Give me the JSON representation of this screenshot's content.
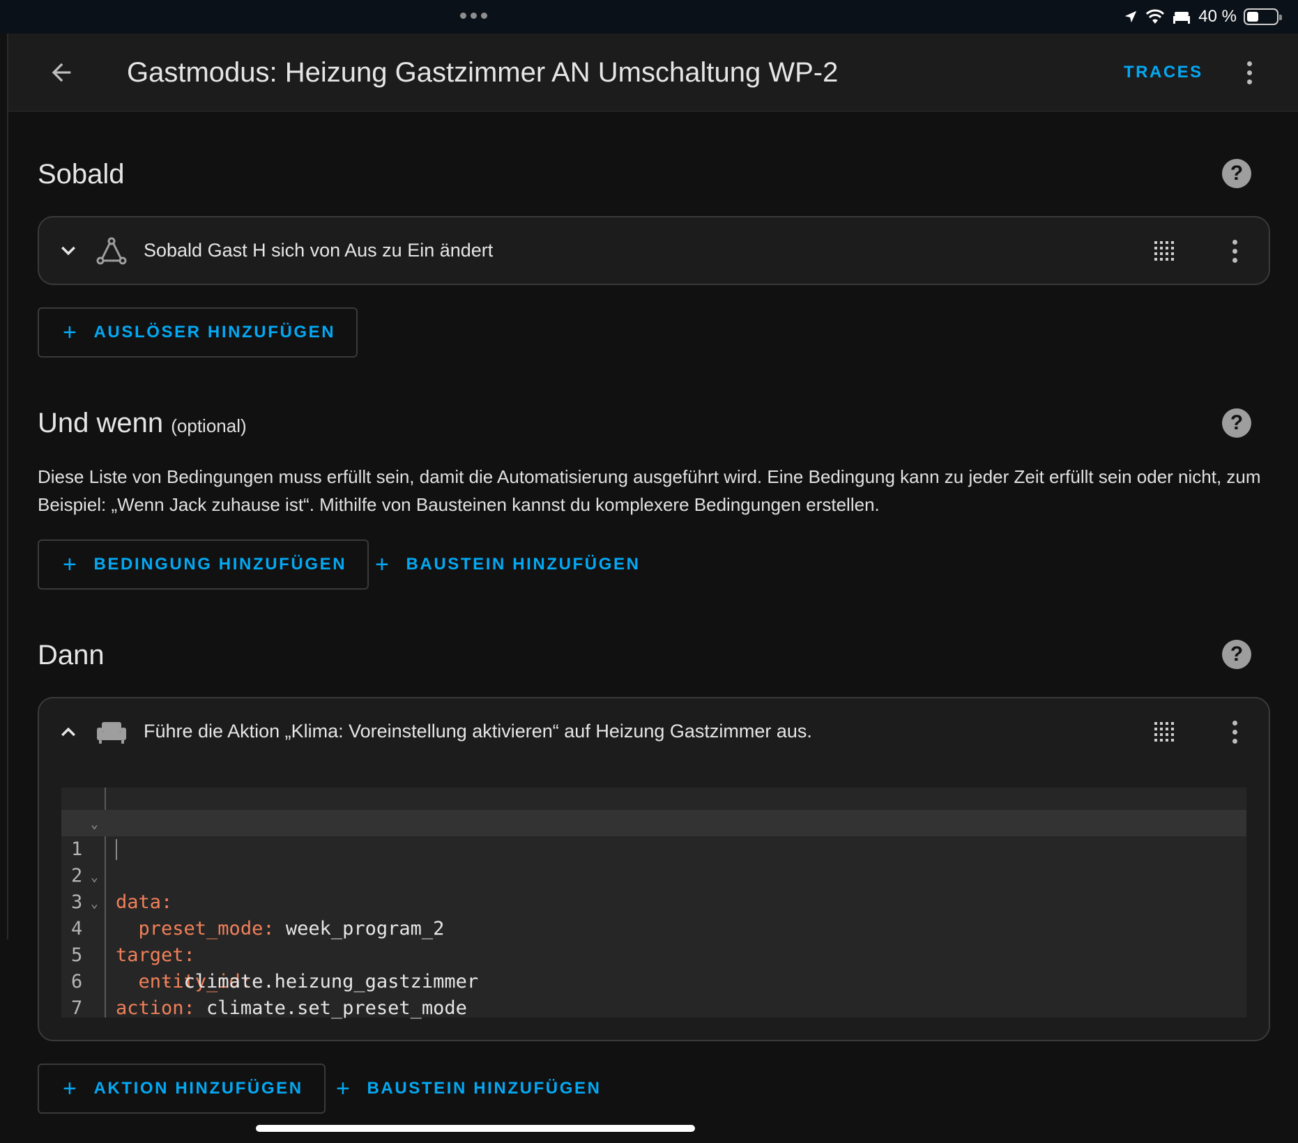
{
  "status_bar": {
    "battery_percent": "40 %",
    "battery_level": 0.4,
    "icons": [
      "location-arrow-icon",
      "wifi-icon",
      "bed-icon",
      "battery-icon"
    ]
  },
  "header": {
    "title": "Gastmodus: Heizung Gastzimmer AN Umschaltung WP-2",
    "traces_label": "TRACES",
    "icons": [
      "arrow-left-icon",
      "dots-vertical-icon"
    ]
  },
  "triggers": {
    "title": "Sobald",
    "items": [
      {
        "text": "Sobald Gast H sich von Aus zu Ein ändert",
        "icon": "state-graph-icon",
        "expanded": false
      }
    ],
    "add_label": "AUSLÖSER HINZUFÜGEN"
  },
  "conditions": {
    "title": "Und wenn",
    "optional_label": "(optional)",
    "description": "Diese Liste von Bedingungen muss erfüllt sein, damit die Automatisierung ausgeführt wird. Eine Bedingung kann zu jeder Zeit erfüllt sein oder nicht, zum Beispiel: „Wenn Jack zuhause ist“. Mithilfe von Bausteinen kannst du komplexere Bedingungen erstellen.",
    "add_condition_label": "BEDINGUNG HINZUFÜGEN",
    "add_block_label": "BAUSTEIN HINZUFÜGEN"
  },
  "actions": {
    "title": "Dann",
    "items": [
      {
        "text": "Führe die Aktion „Klima: Voreinstellung aktivieren“ auf Heizung Gastzimmer aus.",
        "icon": "sofa-icon",
        "expanded": true
      }
    ],
    "yaml": {
      "line_numbers": [
        "1",
        "2",
        "3",
        "4",
        "5",
        "6",
        "7"
      ],
      "l1_key": "data:",
      "l2_key": "preset_mode:",
      "l2_value": " week_program_2",
      "l3_key": "target:",
      "l4_key": "entity_id:",
      "l5_dash": "- ",
      "l5_value": "climate.heizung_gastzimmer",
      "l6_key": "action:",
      "l6_value": " climate.set_preset_mode"
    },
    "add_action_label": "AKTION HINZUFÜGEN",
    "add_block_label": "BAUSTEIN HINZUFÜGEN"
  },
  "colors": {
    "accent": "#03a9f4",
    "background": "#111111",
    "card": "#1c1c1c",
    "yaml_key": "#f0805a"
  }
}
